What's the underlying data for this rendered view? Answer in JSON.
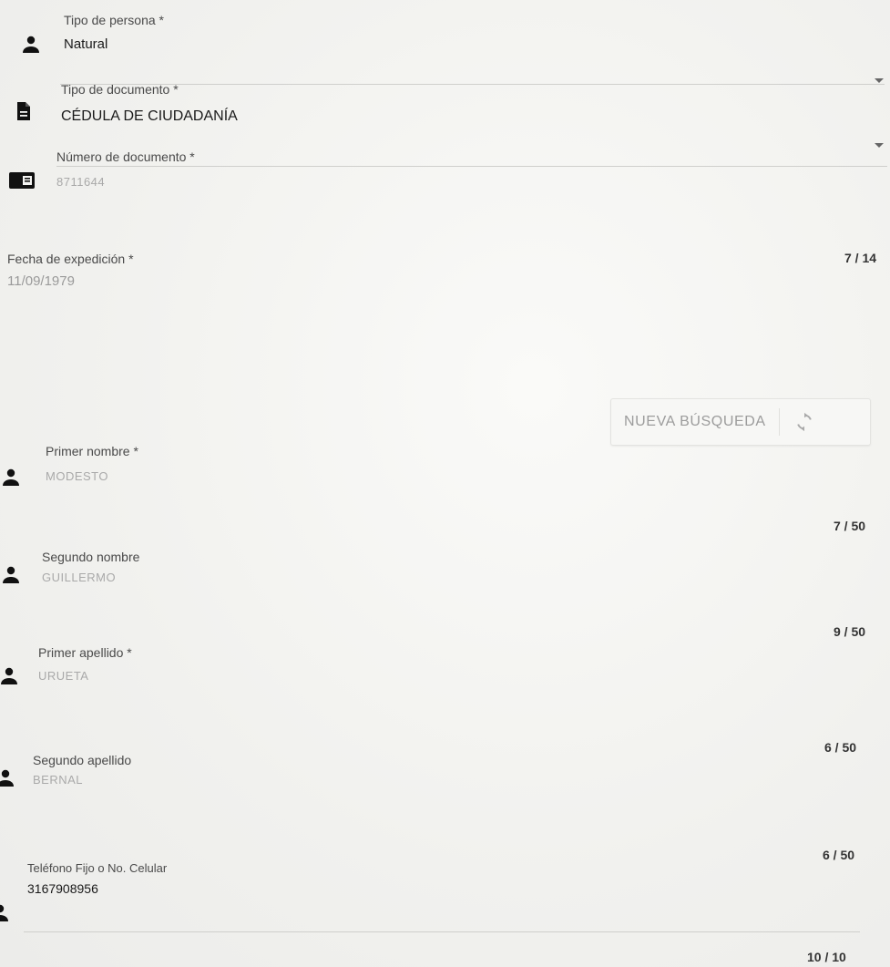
{
  "form": {
    "tipo_persona": {
      "label": "Tipo de persona *",
      "value": "Natural"
    },
    "tipo_documento": {
      "label": "Tipo de documento *",
      "value": "CÉDULA DE CIUDADANÍA"
    },
    "numero_documento": {
      "label": "Número de documento *",
      "value": "8711644",
      "counter": "7 / 14"
    },
    "fecha_expedicion": {
      "label": "Fecha de expedición *",
      "value": "11/09/1979"
    },
    "nueva_busqueda": {
      "label": "NUEVA BÚSQUEDA",
      "icon": "refresh-icon"
    },
    "primer_nombre": {
      "label": "Primer nombre *",
      "value": "MODESTO",
      "counter": "7 / 50"
    },
    "segundo_nombre": {
      "label": "Segundo nombre",
      "value": "GUILLERMO",
      "counter": "9 / 50"
    },
    "primer_apellido": {
      "label": "Primer apellido *",
      "value": "URUETA",
      "counter": "6 / 50"
    },
    "segundo_apellido": {
      "label": "Segundo apellido",
      "value": "BERNAL",
      "counter": "6 / 50"
    },
    "telefono": {
      "label": "Teléfono Fijo o No. Celular",
      "value": "3167908956",
      "counter": "10 / 10"
    }
  },
  "icons": {
    "person": "person-icon",
    "document": "document-icon",
    "id_card": "id-card-icon",
    "dropdown": "chevron-down-icon"
  },
  "colors": {
    "accent_text": "#1a1a1a",
    "muted_text": "#9a9a9a",
    "underline": "#cfcfcc"
  }
}
